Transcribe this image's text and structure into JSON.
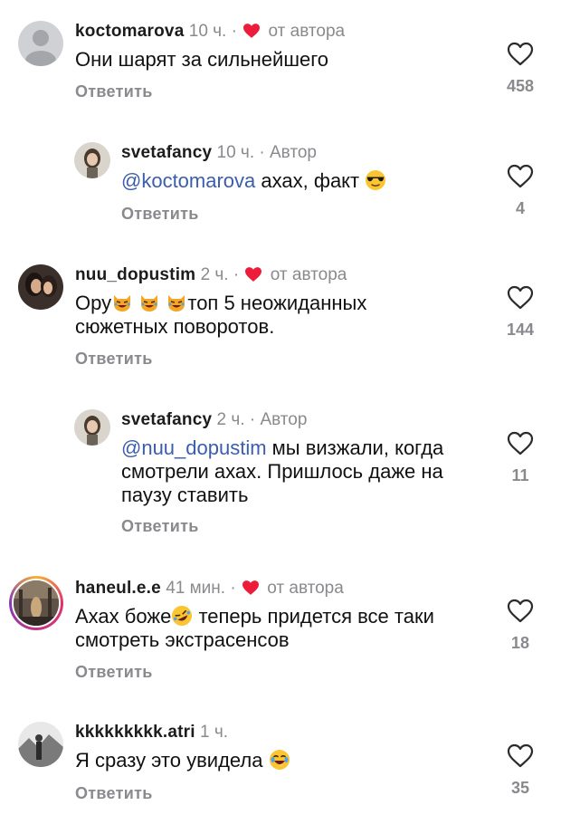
{
  "comments": [
    {
      "username": "koctomarova",
      "time": "10 ч.",
      "tag": "от автора",
      "text": "Они шарят за сильнейшего",
      "reply_label": "Ответить",
      "likes": "458"
    },
    {
      "username": "svetafancy",
      "time": "10 ч.",
      "tag": "Автор",
      "mention": "@koctomarova",
      "text": " ахах, факт",
      "reply_label": "Ответить",
      "likes": "4"
    },
    {
      "username": "nuu_dopustim",
      "time": "2 ч.",
      "tag": "от автора",
      "text_a": "Ору",
      "text_b": "топ 5 неожиданных",
      "text_c": "сюжетных поворотов.",
      "reply_label": "Ответить",
      "likes": "144"
    },
    {
      "username": "svetafancy",
      "time": "2 ч.",
      "tag": "Автор",
      "mention": "@nuu_dopustim",
      "text_a": " мы визжали, когда",
      "text_b": "смотрели ахах. Пришлось даже на",
      "text_c": "паузу ставить",
      "reply_label": "Ответить",
      "likes": "11"
    },
    {
      "username": "haneul.e.e",
      "time": "41 мин.",
      "tag": "от автора",
      "text_a": "Ахах боже",
      "text_b": " теперь придется все таки",
      "text_c": "смотреть экстрасенсов",
      "reply_label": "Ответить",
      "likes": "18"
    },
    {
      "username": "kkkkkkkkk.atri",
      "time": "1 ч.",
      "text": "Я сразу это увидела ",
      "reply_label": "Ответить",
      "likes": "35"
    }
  ],
  "separator": "·",
  "colors": {
    "heart_red": "#ed1c3a",
    "mention_blue": "#3c5dab",
    "muted": "#8a8a8e"
  },
  "icons": [
    "heart-outline-icon",
    "heart-filled-icon",
    "cat-laughing-emoji",
    "rofl-emoji",
    "joy-emoji",
    "sunglasses-emoji"
  ]
}
